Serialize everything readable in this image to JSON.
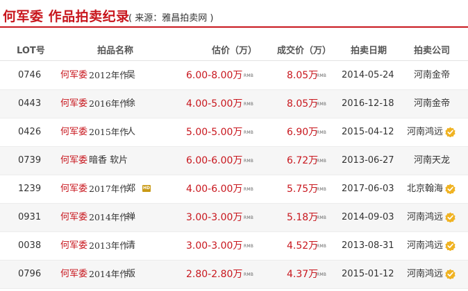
{
  "title": {
    "main": "何军委  作品拍卖纪录",
    "source": "( 来源：雅昌拍卖网 )"
  },
  "columns": {
    "lot": "LOT号",
    "name": "拍品名称",
    "estimate": "估价（万）",
    "price": "成交价（万）",
    "date": "拍卖日期",
    "company": "拍卖公司"
  },
  "currency_tag": "RMB",
  "hd_badge": "HD",
  "rows": [
    {
      "lot": "0746",
      "artist": "何军委",
      "year": "2012年作",
      "work": "吴",
      "estimate": "6.00-8.00万",
      "price": "8.05万",
      "date": "2014-05-24",
      "company": "河南金帝",
      "verified": false,
      "hd": false
    },
    {
      "lot": "0443",
      "artist": "何军委",
      "year": "2016年作",
      "work": "徐",
      "estimate": "4.00-5.00万",
      "price": "8.05万",
      "date": "2016-12-18",
      "company": "河南金帝",
      "verified": false,
      "hd": false
    },
    {
      "lot": "0426",
      "artist": "何军委",
      "year": "2015年作",
      "work": "人",
      "estimate": "5.00-5.00万",
      "price": "6.90万",
      "date": "2015-04-12",
      "company": "河南鸿远",
      "verified": true,
      "hd": false
    },
    {
      "lot": "0739",
      "artist": "何军委",
      "year": "",
      "work": "暗香 软片",
      "estimate": "6.00-6.00万",
      "price": "6.72万",
      "date": "2013-06-27",
      "company": "河南天龙",
      "verified": false,
      "hd": false
    },
    {
      "lot": "1239",
      "artist": "何军委",
      "year": "2017年作",
      "work": "郑",
      "estimate": "4.00-6.00万",
      "price": "5.75万",
      "date": "2017-06-03",
      "company": "北京翰海",
      "verified": true,
      "hd": true
    },
    {
      "lot": "0931",
      "artist": "何军委",
      "year": "2014年作",
      "work": "禅",
      "estimate": "3.00-3.00万",
      "price": "5.18万",
      "date": "2014-09-03",
      "company": "河南鸿远",
      "verified": true,
      "hd": false
    },
    {
      "lot": "0038",
      "artist": "何军委",
      "year": "2013年作",
      "work": "清",
      "estimate": "3.00-3.00万",
      "price": "4.52万",
      "date": "2013-08-31",
      "company": "河南鸿远",
      "verified": true,
      "hd": false
    },
    {
      "lot": "0796",
      "artist": "何军委",
      "year": "2014年作",
      "work": "版",
      "estimate": "2.80-2.80万",
      "price": "4.37万",
      "date": "2015-01-12",
      "company": "河南鸿远",
      "verified": true,
      "hd": false
    }
  ],
  "colors": {
    "accent": "#c8161d",
    "verified_badge": "#f0b323",
    "hd_badge": "#c99a17",
    "alt_row": "#f6f6f6"
  },
  "icons": {
    "verified": "verified-badge-icon",
    "hd": "hd-badge-icon"
  }
}
